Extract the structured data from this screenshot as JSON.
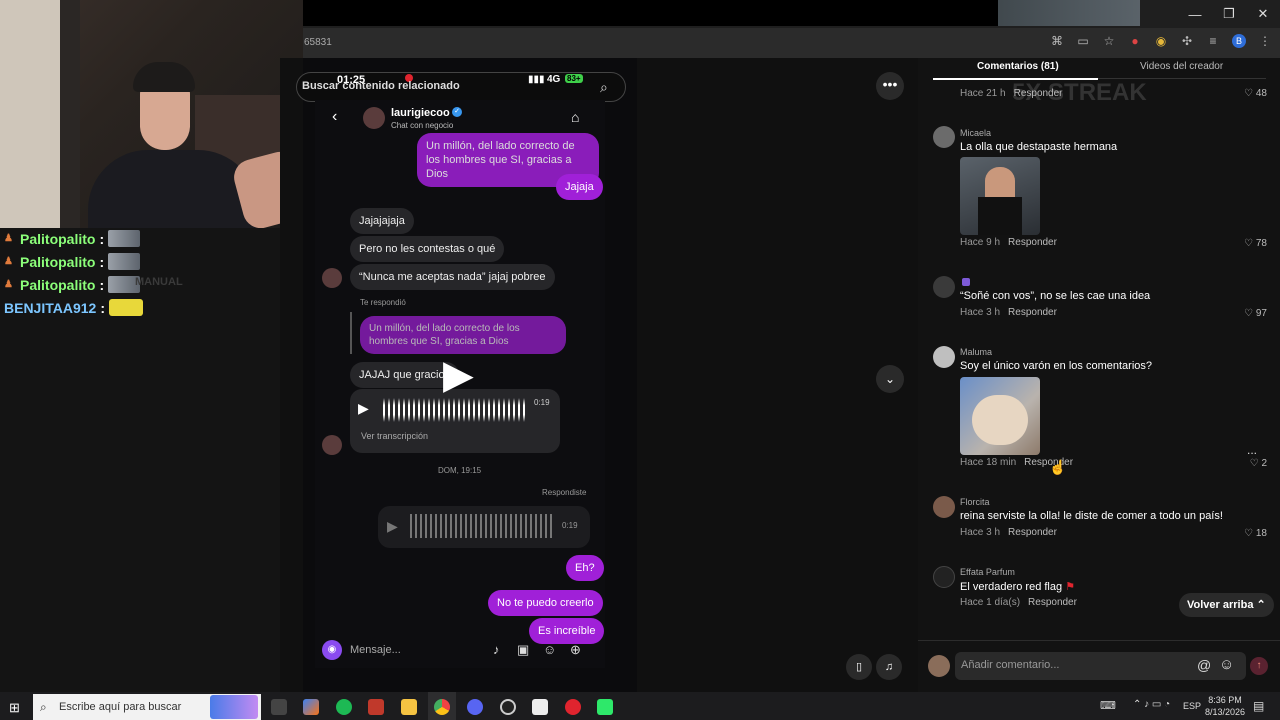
{
  "browser": {
    "url_fragment": "65831"
  },
  "chat": {
    "lines": [
      {
        "name": "Palitopalito",
        "sep": ":"
      },
      {
        "name": "Palitopalito",
        "sep": ":"
      },
      {
        "name": "Palitopalito",
        "sep": ":"
      },
      {
        "name": "BENJITAA912",
        "sep": ":"
      }
    ],
    "overlay_text": "MANUAL"
  },
  "phone": {
    "status_time": "01:25",
    "network": "4G",
    "battery": "83+",
    "search_placeholder": "Buscar contenido relacionado",
    "contact_name": "laurigiecoo",
    "contact_sub": "Chat con negocio",
    "messages": {
      "m1": "Un millón, del lado correcto de los hombres que SI, gracias a Dios",
      "m2": "Jajaja",
      "m3": "Jajajajaja",
      "m4": "Pero no les contestas o qué",
      "m5": "“Nunca me aceptas nada” jajaj pobree",
      "reply_label": "Te respondió",
      "m6": "Un millón, del lado correcto de los hombres que SI, gracias a Dios",
      "m7": "JAJAJ que gracios",
      "voice1_duration": "0:19",
      "transcript": "Ver transcripción",
      "date_sep": "DOM, 19:15",
      "replied_label": "Respondiste",
      "voice2_duration": "0:19",
      "m8": "Eh?",
      "m9": "No te puedo creerlo",
      "m10": "Es increíble"
    },
    "composer_placeholder": "Mensaje..."
  },
  "comments": {
    "tab_comments": "Comentarios (81)",
    "tab_creator": "Videos del creador",
    "streak": "5X STREAK",
    "items": [
      {
        "user": "",
        "text": "",
        "time": "Hace 21 h",
        "reply": "Responder",
        "likes": "48"
      },
      {
        "user": "Micaela",
        "text": "La olla que destapaste hermana",
        "time": "Hace 9 h",
        "reply": "Responder",
        "likes": "78"
      },
      {
        "user": "",
        "text": "“Soñé con vos”, no se les cae una idea",
        "time": "Hace 3 h",
        "reply": "Responder",
        "likes": "97"
      },
      {
        "user": "Maluma",
        "text": "Soy el único varón en los comentarios?",
        "time": "Hace 18 min",
        "reply": "Responder",
        "likes": "2"
      },
      {
        "user": "Florcita",
        "text": "reina serviste la olla! le diste de comer a todo un país!",
        "time": "Hace 3 h",
        "reply": "Responder",
        "likes": "18"
      },
      {
        "user": "Effata Parfum",
        "text": "El verdadero red flag",
        "time": "Hace 1 día(s)",
        "reply": "Responder",
        "likes": ""
      }
    ],
    "back_to_top": "Volver arriba",
    "add_comment_placeholder": "Añadir comentario...",
    "more": "..."
  },
  "taskbar": {
    "search_placeholder": "Escribe aquí para buscar",
    "lang": "ESP",
    "time": "8:36 PM",
    "date": "8/13/2026"
  },
  "colors": {
    "accent_purple": "#a020d8",
    "chat_green": "#8cff7a",
    "like_red": "#fe2c55"
  }
}
